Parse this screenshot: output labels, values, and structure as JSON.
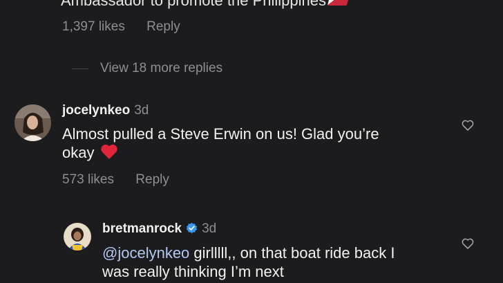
{
  "top_comment": {
    "partial_text": "Ambassador to promote the Philippines",
    "likes": "1,397 likes",
    "reply_label": "Reply"
  },
  "view_more": {
    "label": "View 18 more replies"
  },
  "comment_jocelyn": {
    "username": "jocelynkeo",
    "time": "3d",
    "text_line1": "Almost pulled a Steve Erwin on us! Glad you’re",
    "text_line2": "okay",
    "likes": "573 likes",
    "reply_label": "Reply"
  },
  "reply_bretman": {
    "username": "bretmanrock",
    "time": "3d",
    "mention": "@jocelynkeo",
    "text_line1_rest": " girlllll,, on that boat ride back I",
    "text_line2": "was really thinking I’m next"
  },
  "colors": {
    "background": "#1c1c1e",
    "primary_text": "#f2f2f2",
    "secondary_text": "#8e8e93",
    "heart_red": "#e0243b",
    "verified_blue": "#3897f0"
  }
}
